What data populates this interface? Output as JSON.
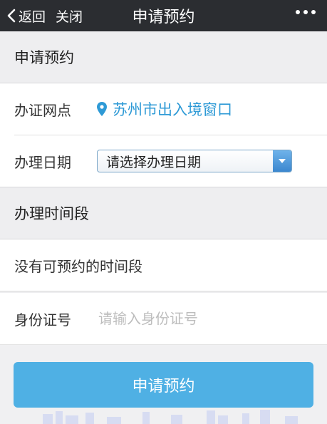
{
  "topbar": {
    "back_label": "返回",
    "close_label": "关闭",
    "title": "申请预约"
  },
  "section": {
    "title": "申请预约"
  },
  "form": {
    "site_label": "办证网点",
    "site_value": "苏州市出入境窗口",
    "date_label": "办理日期",
    "date_selected": "请选择办理日期"
  },
  "time_section": {
    "title": "办理时间段",
    "empty_message": "没有可预约的时间段"
  },
  "id_field": {
    "label": "身份证号",
    "placeholder": "请输入身份证号",
    "value": ""
  },
  "submit_label": "申请预约",
  "colors": {
    "topbar": "#2b2d31",
    "accent": "#2e9ad6",
    "button": "#4fb0e4",
    "background": "#eeeef0"
  },
  "icons": {
    "back": "chevron-left-icon",
    "more": "more-dots-icon",
    "location": "location-pin-icon",
    "dropdown": "dropdown-arrow-icon"
  }
}
